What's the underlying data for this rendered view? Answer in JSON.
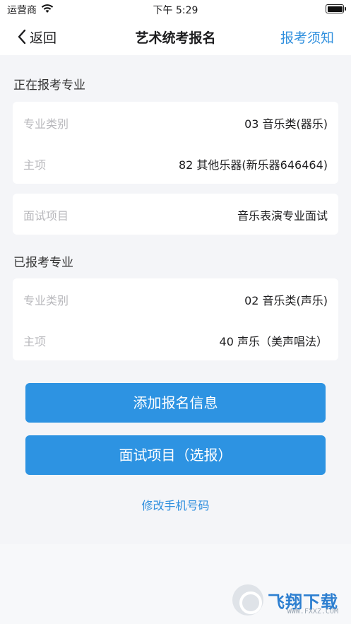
{
  "status_bar": {
    "carrier": "运营商",
    "time": "下午 5:29"
  },
  "nav": {
    "back_label": "返回",
    "title": "艺术统考报名",
    "right_label": "报考须知"
  },
  "current": {
    "section_title": "正在报考专业",
    "rows": [
      {
        "key": "专业类别",
        "value": "03 音乐类(器乐)"
      },
      {
        "key": "主项",
        "value": "82 其他乐器(新乐器646464)"
      }
    ],
    "interview": {
      "key": "面试项目",
      "value": "音乐表演专业面试"
    }
  },
  "applied": {
    "section_title": "已报考专业",
    "rows": [
      {
        "key": "专业类别",
        "value": "02 音乐类(声乐)"
      },
      {
        "key": "主项",
        "value": "40 声乐（美声唱法）"
      }
    ]
  },
  "actions": {
    "add_label": "添加报名信息",
    "interview_label": "面试项目（选报）",
    "change_phone_label": "修改手机号码"
  },
  "watermark": {
    "text": "飞翔下载",
    "url": "WWW.FXXZ.COM"
  },
  "colors": {
    "accent": "#2d93e2",
    "background": "#f4f5f8"
  }
}
